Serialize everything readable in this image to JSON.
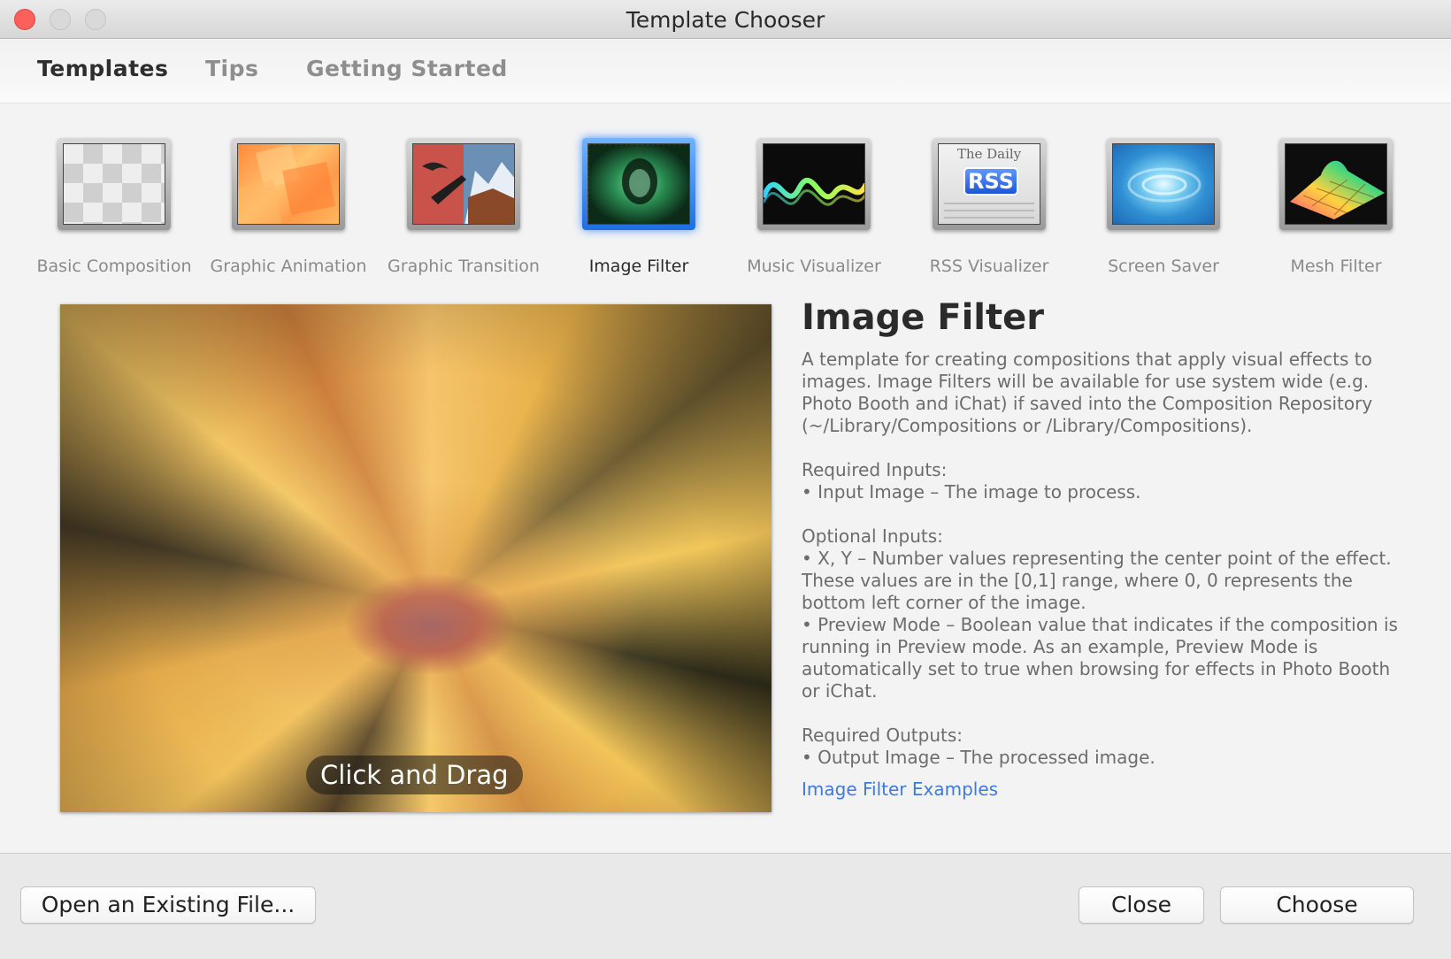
{
  "window": {
    "title": "Template Chooser"
  },
  "tabs": [
    {
      "label": "Templates",
      "active": true
    },
    {
      "label": "Tips",
      "active": false
    },
    {
      "label": "Getting Started",
      "active": false
    }
  ],
  "templates": [
    {
      "label": "Basic Composition",
      "icon": "checkerboard-icon"
    },
    {
      "label": "Graphic Animation",
      "icon": "orange-shapes-icon"
    },
    {
      "label": "Graphic Transition",
      "icon": "photo-transition-icon"
    },
    {
      "label": "Image Filter",
      "icon": "filtered-portrait-icon",
      "selected": true
    },
    {
      "label": "Music Visualizer",
      "icon": "waveform-icon"
    },
    {
      "label": "RSS Visualizer",
      "icon": "rss-newspaper-icon",
      "badge": "RSS",
      "masthead": "The Daily"
    },
    {
      "label": "Screen Saver",
      "icon": "swirl-icon"
    },
    {
      "label": "Mesh Filter",
      "icon": "mesh-surface-icon"
    }
  ],
  "preview": {
    "hint": "Click and Drag"
  },
  "description": {
    "title": "Image Filter",
    "intro": "A template for creating compositions that apply visual effects to images. Image Filters will be available for use system wide (e.g. Photo Booth and iChat) if saved into the Composition Repository (~/Library/Compositions or /Library/Compositions).",
    "required_inputs_heading": "Required Inputs:",
    "required_inputs": [
      "• Input Image – The image to process."
    ],
    "optional_inputs_heading": "Optional Inputs:",
    "optional_inputs": [
      "• X, Y – Number values representing the center point of the effect. These values are in the [0,1] range, where 0, 0 represents the bottom left corner of the image.",
      "• Preview Mode – Boolean value that indicates if the composition is running in Preview mode. As an example, Preview Mode is automatically set to true when browsing for effects in Photo Booth or iChat."
    ],
    "required_outputs_heading": "Required Outputs:",
    "required_outputs": [
      "• Output Image – The processed image."
    ],
    "examples_link": "Image Filter Examples"
  },
  "buttons": {
    "open_existing": "Open an Existing File...",
    "close": "Close",
    "choose": "Choose"
  },
  "colors": {
    "accent": "#3f7ad8",
    "close_light": "#fc605c",
    "selection": "#1d6fe0"
  }
}
